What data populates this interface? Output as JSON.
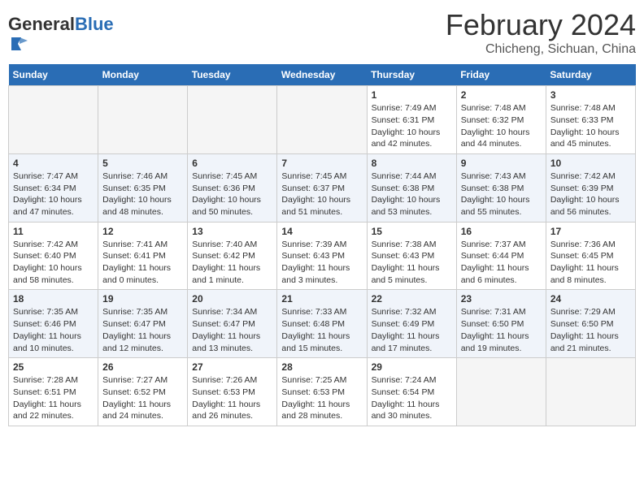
{
  "logo": {
    "general": "General",
    "blue": "Blue"
  },
  "title": "February 2024",
  "subtitle": "Chicheng, Sichuan, China",
  "weekdays": [
    "Sunday",
    "Monday",
    "Tuesday",
    "Wednesday",
    "Thursday",
    "Friday",
    "Saturday"
  ],
  "weeks": [
    [
      {
        "day": "",
        "info": ""
      },
      {
        "day": "",
        "info": ""
      },
      {
        "day": "",
        "info": ""
      },
      {
        "day": "",
        "info": ""
      },
      {
        "day": "1",
        "info": "Sunrise: 7:49 AM\nSunset: 6:31 PM\nDaylight: 10 hours and 42 minutes."
      },
      {
        "day": "2",
        "info": "Sunrise: 7:48 AM\nSunset: 6:32 PM\nDaylight: 10 hours and 44 minutes."
      },
      {
        "day": "3",
        "info": "Sunrise: 7:48 AM\nSunset: 6:33 PM\nDaylight: 10 hours and 45 minutes."
      }
    ],
    [
      {
        "day": "4",
        "info": "Sunrise: 7:47 AM\nSunset: 6:34 PM\nDaylight: 10 hours and 47 minutes."
      },
      {
        "day": "5",
        "info": "Sunrise: 7:46 AM\nSunset: 6:35 PM\nDaylight: 10 hours and 48 minutes."
      },
      {
        "day": "6",
        "info": "Sunrise: 7:45 AM\nSunset: 6:36 PM\nDaylight: 10 hours and 50 minutes."
      },
      {
        "day": "7",
        "info": "Sunrise: 7:45 AM\nSunset: 6:37 PM\nDaylight: 10 hours and 51 minutes."
      },
      {
        "day": "8",
        "info": "Sunrise: 7:44 AM\nSunset: 6:38 PM\nDaylight: 10 hours and 53 minutes."
      },
      {
        "day": "9",
        "info": "Sunrise: 7:43 AM\nSunset: 6:38 PM\nDaylight: 10 hours and 55 minutes."
      },
      {
        "day": "10",
        "info": "Sunrise: 7:42 AM\nSunset: 6:39 PM\nDaylight: 10 hours and 56 minutes."
      }
    ],
    [
      {
        "day": "11",
        "info": "Sunrise: 7:42 AM\nSunset: 6:40 PM\nDaylight: 10 hours and 58 minutes."
      },
      {
        "day": "12",
        "info": "Sunrise: 7:41 AM\nSunset: 6:41 PM\nDaylight: 11 hours and 0 minutes."
      },
      {
        "day": "13",
        "info": "Sunrise: 7:40 AM\nSunset: 6:42 PM\nDaylight: 11 hours and 1 minute."
      },
      {
        "day": "14",
        "info": "Sunrise: 7:39 AM\nSunset: 6:43 PM\nDaylight: 11 hours and 3 minutes."
      },
      {
        "day": "15",
        "info": "Sunrise: 7:38 AM\nSunset: 6:43 PM\nDaylight: 11 hours and 5 minutes."
      },
      {
        "day": "16",
        "info": "Sunrise: 7:37 AM\nSunset: 6:44 PM\nDaylight: 11 hours and 6 minutes."
      },
      {
        "day": "17",
        "info": "Sunrise: 7:36 AM\nSunset: 6:45 PM\nDaylight: 11 hours and 8 minutes."
      }
    ],
    [
      {
        "day": "18",
        "info": "Sunrise: 7:35 AM\nSunset: 6:46 PM\nDaylight: 11 hours and 10 minutes."
      },
      {
        "day": "19",
        "info": "Sunrise: 7:35 AM\nSunset: 6:47 PM\nDaylight: 11 hours and 12 minutes."
      },
      {
        "day": "20",
        "info": "Sunrise: 7:34 AM\nSunset: 6:47 PM\nDaylight: 11 hours and 13 minutes."
      },
      {
        "day": "21",
        "info": "Sunrise: 7:33 AM\nSunset: 6:48 PM\nDaylight: 11 hours and 15 minutes."
      },
      {
        "day": "22",
        "info": "Sunrise: 7:32 AM\nSunset: 6:49 PM\nDaylight: 11 hours and 17 minutes."
      },
      {
        "day": "23",
        "info": "Sunrise: 7:31 AM\nSunset: 6:50 PM\nDaylight: 11 hours and 19 minutes."
      },
      {
        "day": "24",
        "info": "Sunrise: 7:29 AM\nSunset: 6:50 PM\nDaylight: 11 hours and 21 minutes."
      }
    ],
    [
      {
        "day": "25",
        "info": "Sunrise: 7:28 AM\nSunset: 6:51 PM\nDaylight: 11 hours and 22 minutes."
      },
      {
        "day": "26",
        "info": "Sunrise: 7:27 AM\nSunset: 6:52 PM\nDaylight: 11 hours and 24 minutes."
      },
      {
        "day": "27",
        "info": "Sunrise: 7:26 AM\nSunset: 6:53 PM\nDaylight: 11 hours and 26 minutes."
      },
      {
        "day": "28",
        "info": "Sunrise: 7:25 AM\nSunset: 6:53 PM\nDaylight: 11 hours and 28 minutes."
      },
      {
        "day": "29",
        "info": "Sunrise: 7:24 AM\nSunset: 6:54 PM\nDaylight: 11 hours and 30 minutes."
      },
      {
        "day": "",
        "info": ""
      },
      {
        "day": "",
        "info": ""
      }
    ]
  ]
}
